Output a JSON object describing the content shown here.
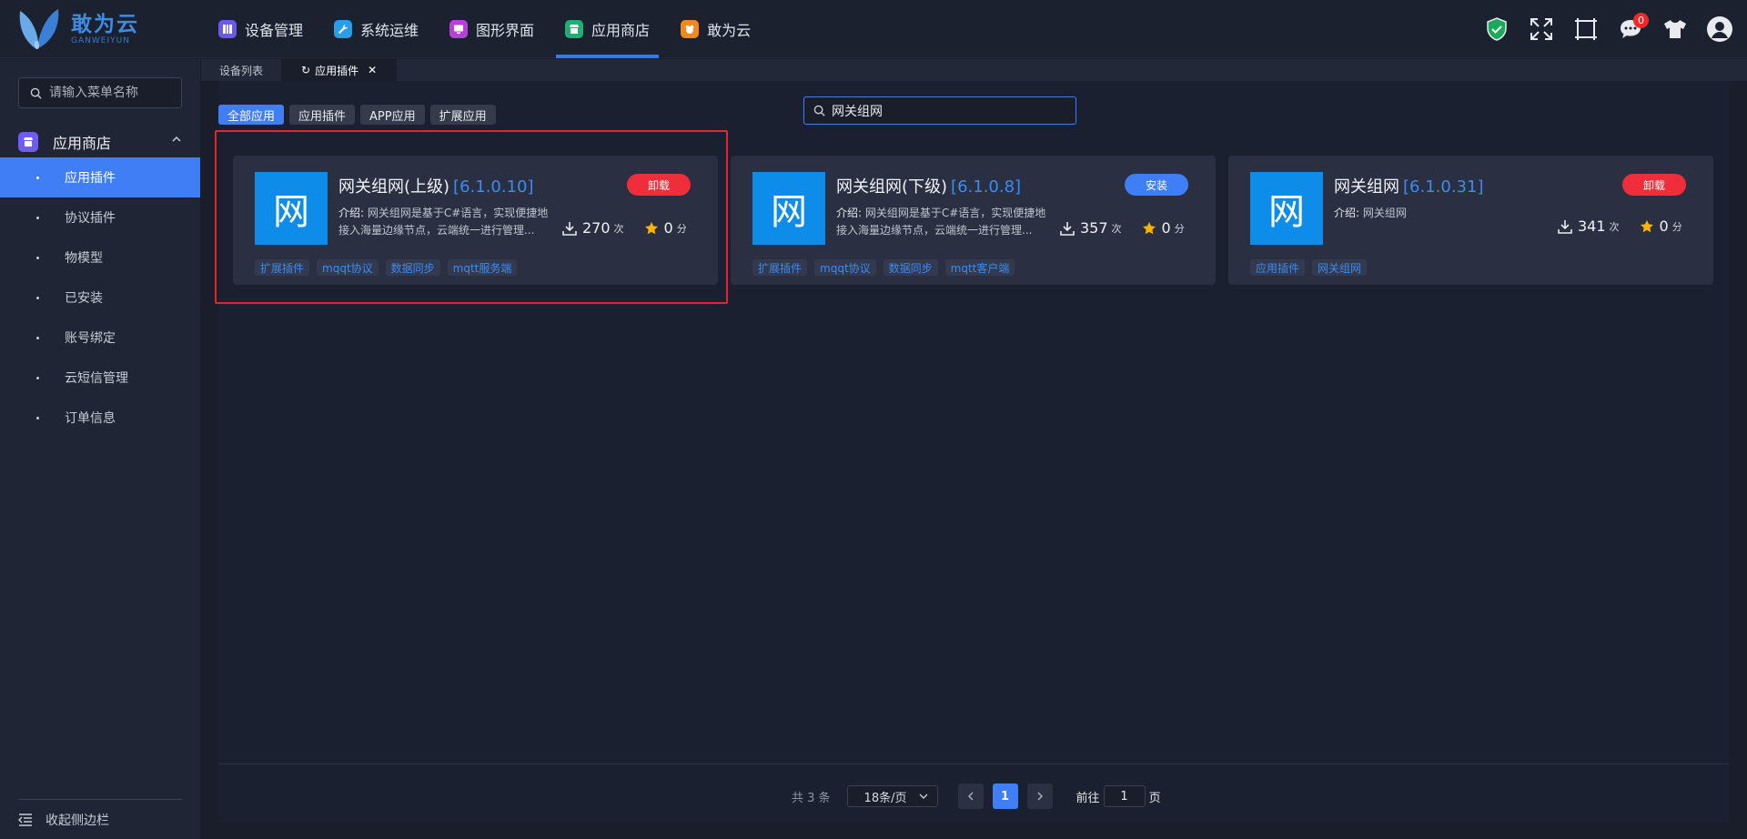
{
  "app": {
    "title": "敢为云",
    "subtitle": "GANWEIYUN"
  },
  "topnav": [
    {
      "label": "设备管理",
      "icon": "device-icon",
      "color": "#6a5ae8"
    },
    {
      "label": "系统运维",
      "icon": "wrench-icon",
      "color": "#2a9de8"
    },
    {
      "label": "图形界面",
      "icon": "monitor-icon",
      "color": "#b541d8"
    },
    {
      "label": "应用商店",
      "icon": "store-icon",
      "color": "#1fae74",
      "active": true
    },
    {
      "label": "敢为云",
      "icon": "cloud-icon",
      "color": "#f08a1e"
    }
  ],
  "header_icons": {
    "notification_count": "0"
  },
  "sidebar": {
    "search_placeholder": "请输入菜单名称",
    "group_label": "应用商店",
    "items": [
      {
        "label": "应用插件",
        "active": true
      },
      {
        "label": "协议插件"
      },
      {
        "label": "物模型"
      },
      {
        "label": "已安装"
      },
      {
        "label": "账号绑定"
      },
      {
        "label": "云短信管理"
      },
      {
        "label": "订单信息"
      }
    ],
    "collapse_label": "收起侧边栏"
  },
  "tabs": [
    {
      "label": "设备列表"
    },
    {
      "label": "应用插件",
      "active": true
    }
  ],
  "filters": [
    {
      "label": "全部应用",
      "active": true
    },
    {
      "label": "应用插件"
    },
    {
      "label": "APP应用"
    },
    {
      "label": "扩展应用"
    }
  ],
  "search": {
    "value": "网关组网"
  },
  "cards": [
    {
      "logo": "网",
      "title": "网关组网(上级)",
      "version": "[6.1.0.10]",
      "desc_label": "介绍:",
      "desc": "网关组网是基于C#语言，实现便捷地接入海量边缘节点，云端统一进行管理...",
      "button": "卸载",
      "button_type": "uninstall",
      "downloads": "270",
      "downloads_unit": "次",
      "score": "0",
      "score_unit": "分",
      "tags": [
        "扩展插件",
        "mqqt协议",
        "数据同步",
        "mqtt服务端"
      ]
    },
    {
      "logo": "网",
      "title": "网关组网(下级)",
      "version": "[6.1.0.8]",
      "desc_label": "介绍:",
      "desc": "网关组网是基于C#语言，实现便捷地接入海量边缘节点，云端统一进行管理...",
      "button": "安装",
      "button_type": "install",
      "downloads": "357",
      "downloads_unit": "次",
      "score": "0",
      "score_unit": "分",
      "tags": [
        "扩展插件",
        "mqqt协议",
        "数据同步",
        "mqtt客户端"
      ]
    },
    {
      "logo": "网",
      "title": "网关组网",
      "version": "[6.1.0.31]",
      "desc_label": "介绍:",
      "desc": "网关组网",
      "button": "卸载",
      "button_type": "uninstall",
      "downloads": "341",
      "downloads_unit": "次",
      "score": "0",
      "score_unit": "分",
      "tags": [
        "应用插件",
        "网关组网"
      ]
    }
  ],
  "pagination": {
    "total": "共 3 条",
    "page_size": "18条/页",
    "current": "1",
    "goto_label": "前往",
    "goto_value": "1",
    "goto_suffix": "页"
  }
}
